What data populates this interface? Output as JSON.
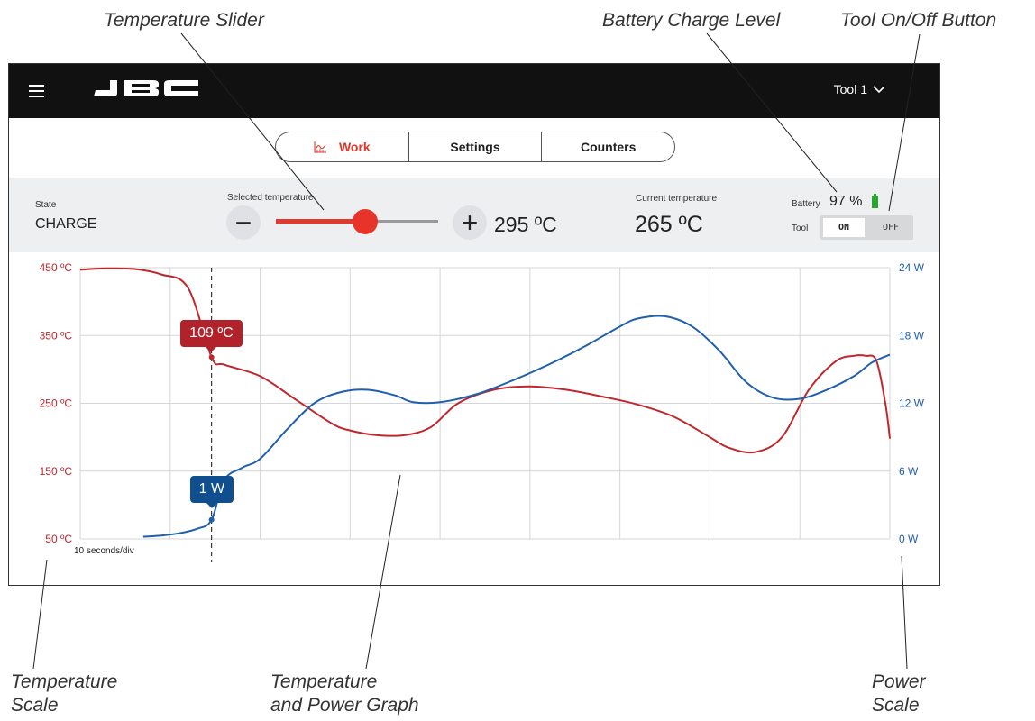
{
  "callouts": {
    "temperature_slider": "Temperature Slider",
    "battery_charge_level": "Battery Charge Level",
    "tool_on_off_button": "Tool On/Off Button",
    "temperature_scale_line1": "Temperature",
    "temperature_scale_line2": "Scale",
    "graph_line1": "Temperature",
    "graph_line2": "and Power Graph",
    "power_scale_line1": "Power",
    "power_scale_line2": "Scale"
  },
  "header": {
    "logo_icon": "jbc-logo",
    "menu_icon": "hamburger-menu-icon",
    "tool_selector": "Tool 1"
  },
  "tabs": [
    {
      "label": "Work",
      "active": true,
      "icon": "chart-icon"
    },
    {
      "label": "Settings",
      "active": false
    },
    {
      "label": "Counters",
      "active": false
    }
  ],
  "status": {
    "state_label": "State",
    "state_value": "CHARGE",
    "selected_temp_label": "Selected temperature",
    "selected_temp_value": "295 ºC",
    "slider_fraction": 0.55,
    "current_temp_label": "Current temperature",
    "current_temp_value": "265 ºC",
    "battery_label": "Battery",
    "battery_value": "97 %",
    "tool_label": "Tool",
    "tool_on": "ON",
    "tool_off": "OFF",
    "tool_state": "ON"
  },
  "colors": {
    "accent": "#e03a2e",
    "temperature": "#c0262c",
    "power": "#1f5fae",
    "battery": "#2aa52e"
  },
  "chart_data": {
    "type": "line",
    "x_division_label": "10 seconds/div",
    "y_left": {
      "ticks": [
        "50 ºC",
        "150 ºC",
        "250 ºC",
        "350 ºC",
        "450 ºC"
      ],
      "values": [
        50,
        150,
        250,
        350,
        450
      ],
      "range": [
        50,
        450
      ]
    },
    "y_right": {
      "ticks": [
        "0 W",
        "6 W",
        "12 W",
        "18 W",
        "24 W"
      ],
      "values": [
        0,
        6,
        12,
        18,
        24
      ],
      "range": [
        0,
        24
      ]
    },
    "x_range": [
      0,
      90
    ],
    "grid": true,
    "series": [
      {
        "axis": "left",
        "x": [
          0,
          3,
          6,
          9,
          12,
          14.6,
          16,
          20,
          24,
          28,
          30,
          33,
          36,
          39,
          42,
          46,
          50,
          54,
          58,
          62,
          66,
          70,
          72,
          75,
          78,
          81,
          84,
          86,
          87.3,
          88.5,
          89.5,
          90
        ],
        "y": [
          447,
          449,
          448,
          440,
          420,
          318,
          307,
          290,
          255,
          220,
          210,
          203,
          203,
          215,
          250,
          270,
          275,
          270,
          260,
          248,
          230,
          200,
          185,
          178,
          200,
          270,
          312,
          320,
          320,
          313,
          250,
          198
        ]
      },
      {
        "axis": "right",
        "x": [
          7,
          9,
          11,
          13,
          14.6,
          16,
          18,
          20,
          23,
          26,
          29,
          32,
          35,
          37,
          40,
          44,
          48,
          52,
          56,
          60,
          62,
          65,
          68,
          71,
          74,
          77,
          80,
          83,
          86,
          88,
          90
        ],
        "y": [
          0.2,
          0.3,
          0.5,
          0.9,
          1.7,
          5.2,
          6.3,
          7.1,
          9.7,
          12,
          13,
          13.2,
          12.7,
          12.1,
          12.1,
          12.8,
          14,
          15.4,
          17,
          18.8,
          19.5,
          19.7,
          18.8,
          16.7,
          13.9,
          12.5,
          12.4,
          13.2,
          14.4,
          15.6,
          16.3
        ]
      }
    ],
    "cursor": {
      "x": 14.6,
      "temp_label": "109 ºC",
      "power_label": "1 W"
    }
  }
}
